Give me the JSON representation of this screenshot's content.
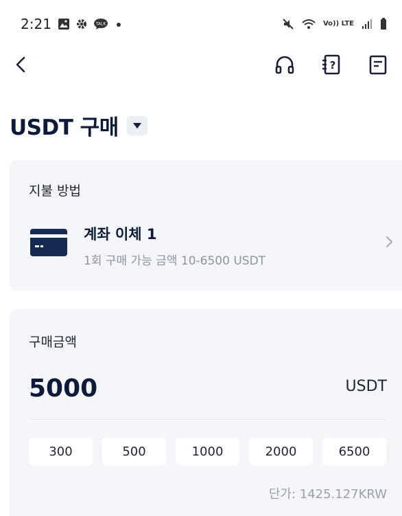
{
  "status_bar": {
    "time": "2:21",
    "left_icons": [
      "gallery-icon",
      "settings-icon",
      "talk-icon",
      "dot-icon"
    ],
    "volte": "Vo)) LTE",
    "right_icons": [
      "mute-icon",
      "wifi-icon",
      "signal-icon",
      "battery-icon"
    ]
  },
  "nav": {
    "back_icon": "chevron-left-icon",
    "right_icons": [
      "headset-icon",
      "help-book-icon",
      "order-list-icon"
    ]
  },
  "title": {
    "text": "USDT 구매",
    "dropdown_icon": "caret-down-icon"
  },
  "payment": {
    "label": "지불 방법",
    "method_title": "계좌 이체 1",
    "method_limit": "1회 구매 가능 금액 10-6500 USDT",
    "icon": "bank-card-icon"
  },
  "amount": {
    "label": "구매금액",
    "value": "5000",
    "unit": "USDT",
    "presets": [
      "300",
      "500",
      "1000",
      "2000",
      "6500"
    ],
    "unit_price": "단가: 1425.127KRW"
  },
  "colors": {
    "primary_dark": "#0d1a3a",
    "card_bg": "#f4f6f9",
    "muted_text": "#8d93a1"
  }
}
